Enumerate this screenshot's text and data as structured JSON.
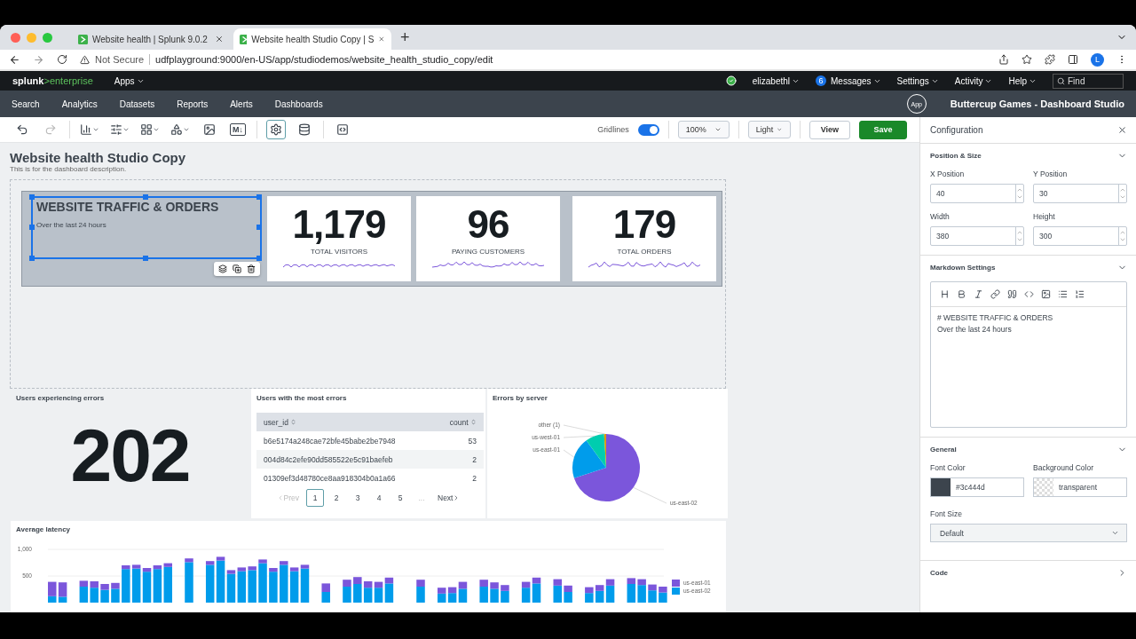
{
  "browser": {
    "tabs": [
      {
        "title": "Website health | Splunk 9.0.2",
        "selected": false
      },
      {
        "title": "Website health Studio Copy | S",
        "selected": true
      }
    ],
    "new_tab": "+",
    "security": "Not Secure",
    "url": "udfplayground:9000/en-US/app/studiodemos/website_health_studio_copy/edit",
    "profile": "L"
  },
  "topbar": {
    "logo_brand": "splunk",
    "logo_product": ">enterprise",
    "apps": "Apps",
    "user": "elizabethl",
    "messages_count": "6",
    "messages": "Messages",
    "menus": [
      "Settings",
      "Activity",
      "Help"
    ],
    "search_placeholder": "Find"
  },
  "nav": {
    "items": [
      "Search",
      "Analytics",
      "Datasets",
      "Reports",
      "Alerts",
      "Dashboards"
    ],
    "app_badge": "App",
    "app_title": "Buttercup Games - Dashboard Studio"
  },
  "toolbar": {
    "tools": [
      {
        "kind": "undo",
        "disabled": false
      },
      {
        "kind": "redo",
        "disabled": true
      },
      {
        "kind": "chart",
        "disabled": false
      },
      {
        "kind": "inputs",
        "disabled": false
      },
      {
        "kind": "layout",
        "disabled": false
      },
      {
        "kind": "shapes",
        "disabled": false
      },
      {
        "kind": "image",
        "disabled": false
      },
      {
        "kind": "markdown",
        "label": "M↓",
        "disabled": false
      },
      {
        "kind": "settings",
        "selected": true
      },
      {
        "kind": "data",
        "selected": false
      },
      {
        "kind": "source",
        "selected": false
      }
    ],
    "gridlines": {
      "label": "Gridlines",
      "on": true
    },
    "zoom": "100%",
    "theme": "Light",
    "view": "View",
    "save": "Save"
  },
  "dashboard": {
    "title": "Website health Studio Copy",
    "description": "This is for the dashboard description.",
    "markdown": {
      "heading": "WEBSITE TRAFFIC & ORDERS",
      "text": "Over the last 24 hours",
      "selected": true
    },
    "singles": [
      {
        "value": "1,179",
        "label": "TOTAL VISITORS"
      },
      {
        "value": "96",
        "label": "PAYING CUSTOMERS"
      },
      {
        "value": "179",
        "label": "TOTAL ORDERS"
      }
    ],
    "users_errors": {
      "title": "Users experiencing errors",
      "value": "202"
    },
    "table": {
      "title": "Users with the most errors",
      "columns": [
        "user_id",
        "count"
      ],
      "rows": [
        [
          "b6e5174a248cae72bfe45babe2be7948",
          "53"
        ],
        [
          "004d84c2efe90dd585522e5c91baefeb",
          "2"
        ],
        [
          "01309ef3d48780ce8aa918304b0a1a66",
          "2"
        ]
      ],
      "pagination": {
        "prev": {
          "label": "Prev",
          "disabled": true
        },
        "pages": [
          {
            "label": "1",
            "selected": true
          },
          {
            "label": "2",
            "selected": false
          },
          {
            "label": "3",
            "selected": false
          },
          {
            "label": "4",
            "selected": false
          },
          {
            "label": "5",
            "selected": false
          }
        ],
        "ellipsis": "...",
        "next": {
          "label": "Next",
          "disabled": false
        }
      }
    },
    "pie": {
      "title": "Errors by server",
      "chart_data": {
        "type": "pie",
        "categories": [
          "us-east-02",
          "us-east-01",
          "us-west-01",
          "other (1)"
        ],
        "values": [
          70,
          20,
          9,
          1
        ]
      }
    },
    "latency": {
      "title": "Average latency",
      "chart_data": {
        "type": "bar",
        "stacked": true,
        "legend": "right",
        "ylim": [
          0,
          1000
        ],
        "yticks": [
          {
            "value": 500,
            "label": "500"
          },
          {
            "value": 1000,
            "label": "1,000"
          }
        ],
        "series": [
          {
            "name": "us-east-02",
            "color": "#009ceb",
            "values": [
              120,
              110,
              null,
              300,
              280,
              240,
              260,
              630,
              640,
              580,
              630,
              670,
              null,
              760,
              null,
              710,
              790,
              540,
              590,
              610,
              740,
              580,
              710,
              590,
              640,
              null,
              200,
              null,
              300,
              350,
              280,
              280,
              360,
              null,
              null,
              300,
              null,
              170,
              180,
              260,
              null,
              300,
              260,
              220,
              null,
              280,
              360,
              null,
              320,
              200,
              null,
              180,
              220,
              320,
              null,
              350,
              330,
              230,
              190
            ]
          },
          {
            "name": "us-east-01",
            "color": "#7b56db",
            "values": [
              270,
              270,
              null,
              110,
              120,
              110,
              110,
              70,
              70,
              70,
              70,
              70,
              null,
              70,
              null,
              70,
              70,
              70,
              70,
              70,
              70,
              70,
              70,
              70,
              70,
              null,
              160,
              null,
              130,
              130,
              120,
              110,
              110,
              null,
              null,
              130,
              null,
              110,
              110,
              130,
              null,
              130,
              120,
              110,
              null,
              110,
              110,
              null,
              120,
              120,
              null,
              110,
              110,
              120,
              null,
              110,
              110,
              110,
              110
            ]
          }
        ]
      }
    }
  },
  "config": {
    "title": "Configuration",
    "position": {
      "title": "Position & Size",
      "fields": [
        {
          "label": "X Position",
          "value": "40"
        },
        {
          "label": "Y Position",
          "value": "30"
        },
        {
          "label": "Width",
          "value": "380"
        },
        {
          "label": "Height",
          "value": "300"
        }
      ]
    },
    "markdown": {
      "title": "Markdown Settings",
      "lines": [
        "# WEBSITE TRAFFIC & ORDERS",
        "Over the last 24 hours"
      ]
    },
    "general": {
      "title": "General",
      "font_color_label": "Font Color",
      "font_color": "#3c444d",
      "bg_color_label": "Background Color",
      "bg_color": "transparent",
      "font_size_label": "Font Size",
      "font_size": "Default"
    },
    "code": {
      "title": "Code",
      "expanded": false
    }
  }
}
